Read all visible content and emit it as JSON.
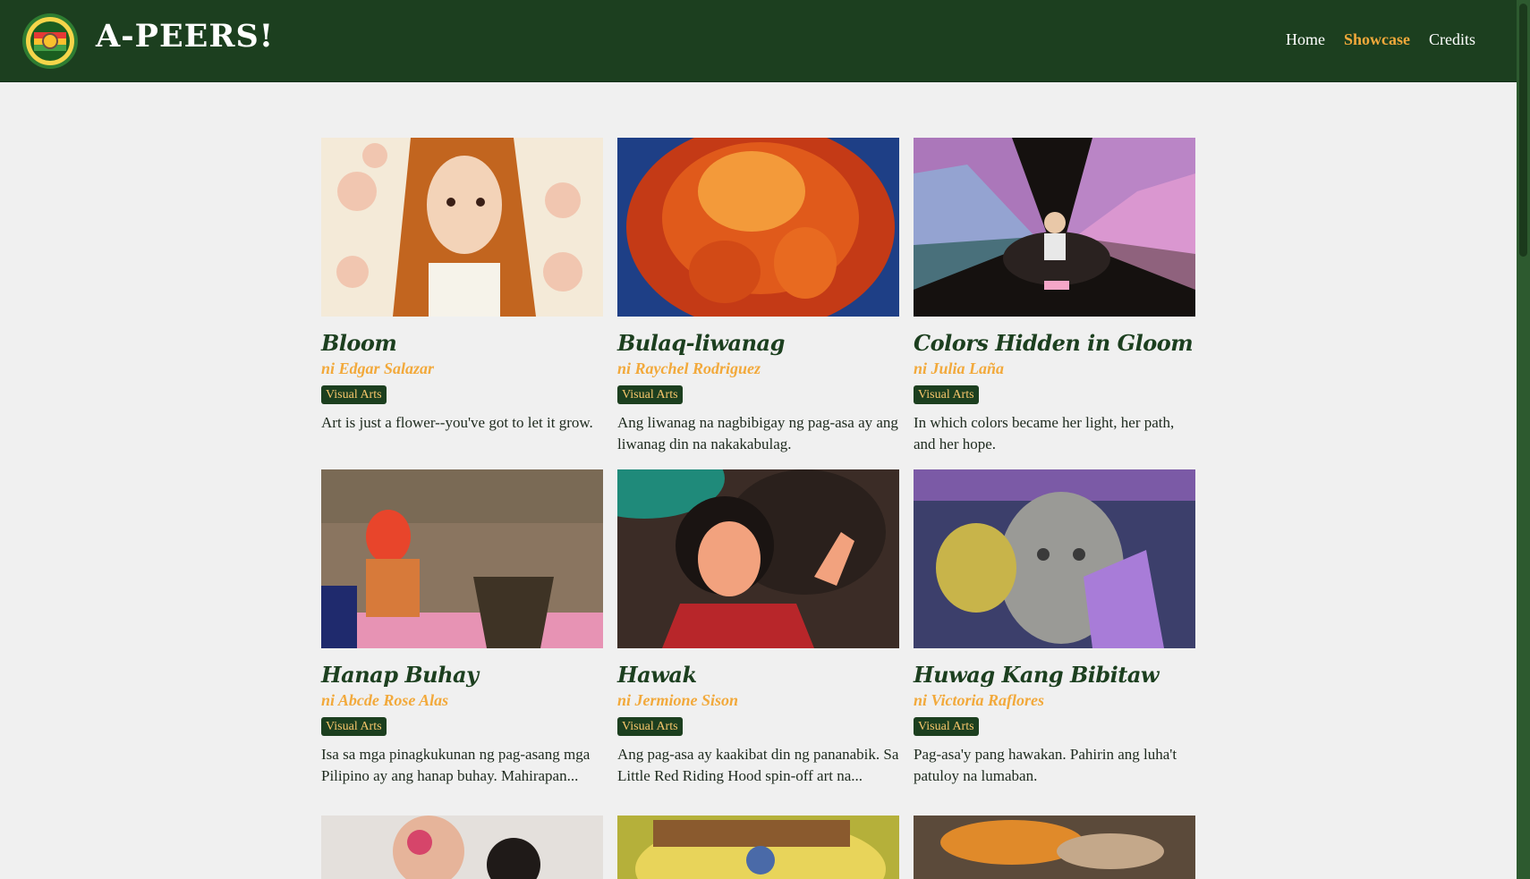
{
  "header": {
    "brand": "A-PEERS!",
    "nav": [
      {
        "label": "Home",
        "active": false
      },
      {
        "label": "Showcase",
        "active": true
      },
      {
        "label": "Credits",
        "active": false
      }
    ]
  },
  "colors": {
    "header_bg": "#1c3f1f",
    "accent": "#f2a93b",
    "page_bg": "#f0f0f0"
  },
  "cards": [
    {
      "title": "Bloom",
      "author": "ni Edgar Salazar",
      "category": "Visual Arts",
      "description": "Art is just a flower--you've got to let it grow."
    },
    {
      "title": "Bulaq-liwanag",
      "author": "ni Raychel Rodriguez",
      "category": "Visual Arts",
      "description": "Ang liwanag na nagbibigay ng pag-asa ay ang liwanag din na nakakabulag."
    },
    {
      "title": "Colors Hidden in Gloom",
      "author": "ni Julia Laña",
      "category": "Visual Arts",
      "description": "In which colors became her light, her path, and her hope."
    },
    {
      "title": "Hanap Buhay",
      "author": "ni Abcde Rose Alas",
      "category": "Visual Arts",
      "description": "Isa sa mga pinagkukunan ng pag-asang mga Pilipino ay ang hanap buhay. Mahirapan..."
    },
    {
      "title": "Hawak",
      "author": "ni Jermione Sison",
      "category": "Visual Arts",
      "description": "Ang pag-asa ay kaakibat din ng pananabik. Sa Little Red Riding Hood spin-off art na..."
    },
    {
      "title": "Huwag Kang Bibitaw",
      "author": "ni Victoria Raflores",
      "category": "Visual Arts",
      "description": "Pag-asa'y pang hawakan. Pahirin ang luha't patuloy na lumaban."
    }
  ]
}
